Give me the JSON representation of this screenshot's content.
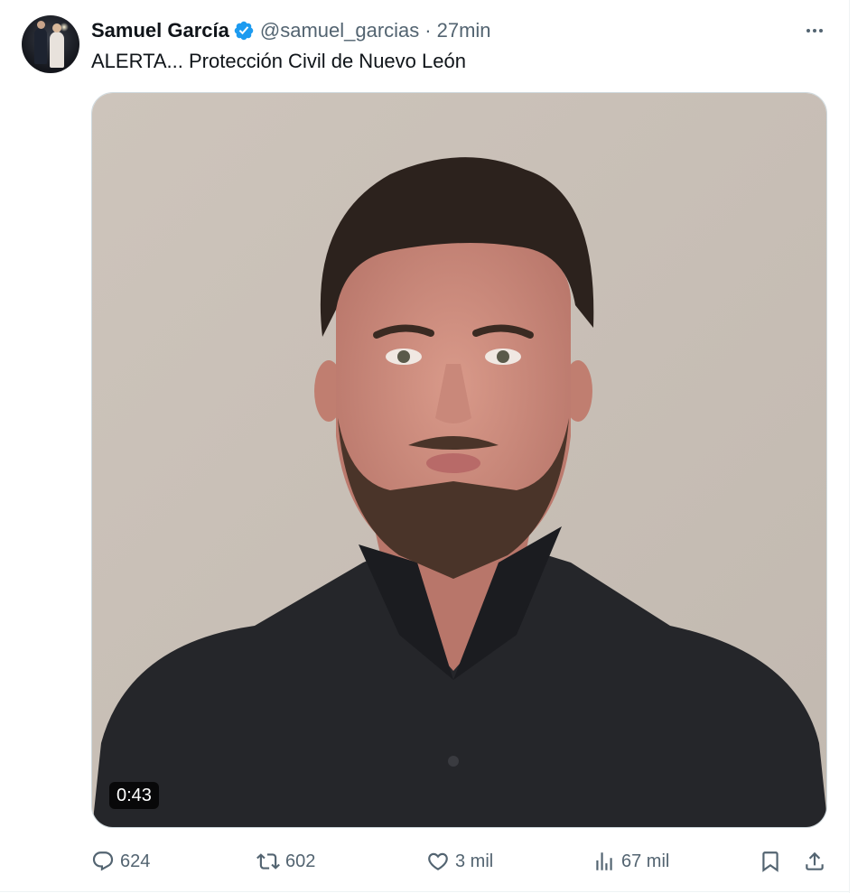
{
  "author": {
    "display_name": "Samuel García",
    "handle": "@samuel_garcias",
    "separator": "·",
    "time": "27min",
    "verified_color": "#1d9bf0"
  },
  "tweet": {
    "text": "ALERTA... Protección Civil de Nuevo León"
  },
  "media": {
    "type": "video",
    "duration": "0:43"
  },
  "actions": {
    "reply_count": "624",
    "retweet_count": "602",
    "like_count": "3 mil",
    "views_count": "67 mil"
  },
  "icons": {
    "more": "more-horizontal-icon",
    "reply": "reply-icon",
    "retweet": "retweet-icon",
    "like": "heart-icon",
    "views": "analytics-icon",
    "bookmark": "bookmark-icon",
    "share": "share-icon"
  },
  "colors": {
    "text_primary": "#0f1419",
    "text_secondary": "#536471",
    "border": "#cfd9de",
    "accent": "#1d9bf0"
  }
}
